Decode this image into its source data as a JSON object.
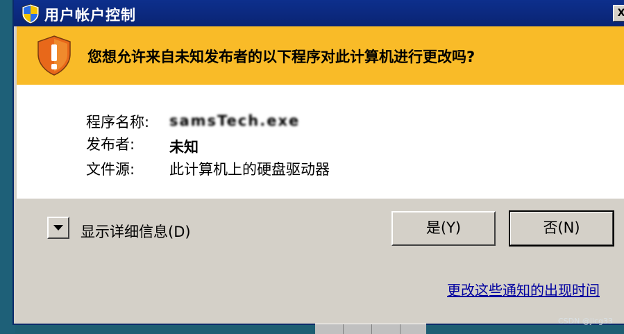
{
  "window": {
    "title": "用户帐户控制",
    "close_glyph": "X"
  },
  "banner": {
    "question": "您想允许来自未知发布者的以下程序对此计算机进行更改吗?"
  },
  "details": {
    "program_name_label": "程序名称:",
    "program_name_value": "samsTech.exe",
    "publisher_label": "发布者:",
    "publisher_value": "未知",
    "file_origin_label": "文件源:",
    "file_origin_value": "此计算机上的硬盘驱动器"
  },
  "footer": {
    "show_details_label": "显示详细信息(D)",
    "yes_label": "是(Y)",
    "no_label": "否(N)",
    "notify_link": "更改这些通知的出现时间"
  },
  "watermark": "CSDN @jicg33",
  "colors": {
    "titlebar": "#0d2f8c",
    "banner": "#f9bb28",
    "dialog_bg": "#d4d0c8",
    "link": "#0000a0"
  },
  "icons": [
    "uac-shield-icon",
    "warning-shield-icon",
    "chevron-down-icon",
    "close-icon"
  ]
}
